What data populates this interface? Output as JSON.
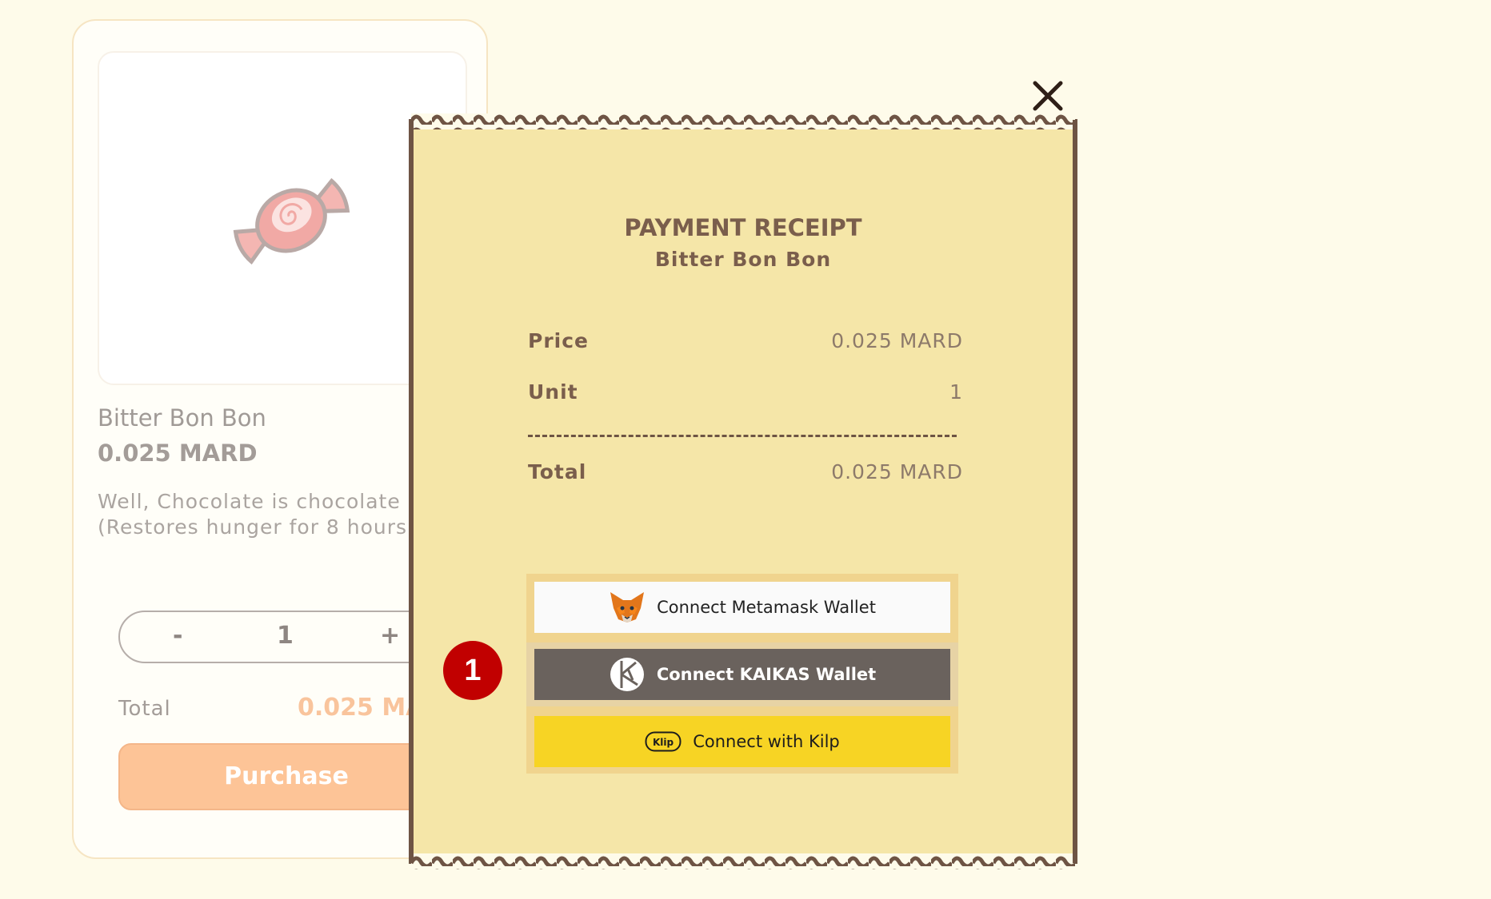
{
  "product": {
    "name": "Bitter Bon Bon",
    "price": "0.025 MARD",
    "description_lines": [
      "Well, Chocolate is chocolate",
      "(Restores hunger for 8 hours"
    ],
    "quantity": {
      "minus": "-",
      "value": "1",
      "plus": "+"
    },
    "total_label": "Total",
    "total_value": "0.025 MA",
    "purchase_label": "Purchase",
    "icon": "candy-icon"
  },
  "receipt": {
    "title": "PAYMENT RECEIPT",
    "subtitle": "Bitter Bon Bon",
    "rows": [
      {
        "label": "Price",
        "value": "0.025 MARD"
      },
      {
        "label": "Unit",
        "value": "1"
      }
    ],
    "total": {
      "label": "Total",
      "value": "0.025 MARD"
    },
    "close_icon": "close-icon"
  },
  "wallets": {
    "metamask": {
      "label": "Connect Metamask Wallet",
      "icon": "metamask-fox-icon"
    },
    "kaikas": {
      "label": "Connect KAIKAS Wallet",
      "icon": "kaikas-icon"
    },
    "klip": {
      "label": "Connect with Kilp",
      "icon": "klip-icon",
      "icon_text": "Klip"
    }
  },
  "annotation": {
    "step": "1"
  },
  "colors": {
    "page_bg": "#fefbea",
    "receipt_bg": "#f5e6a8",
    "receipt_border": "#6e5444",
    "purchase": "#fdc497",
    "kaikas_button": "#6a625d",
    "klip_button": "#f7d424",
    "badge": "#c10000"
  }
}
